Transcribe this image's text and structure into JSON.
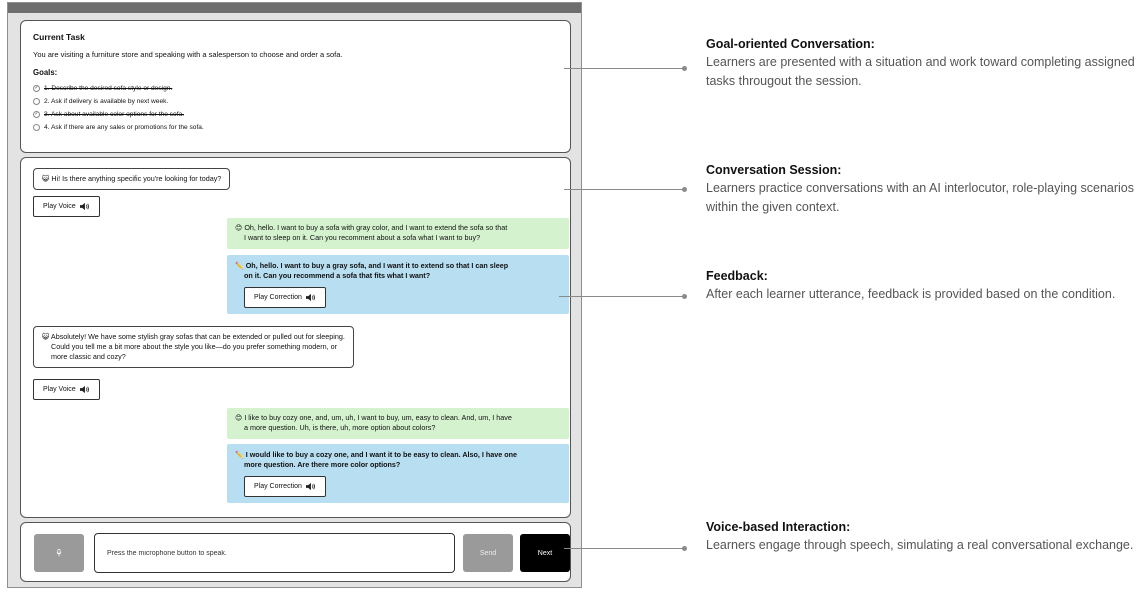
{
  "task": {
    "title": "Current Task",
    "description": "You are visiting a furniture store and speaking with a salesperson to choose and order a sofa.",
    "goals_title": "Goals:",
    "goals": [
      {
        "text": "1. Describe the desired sofa style or design.",
        "done": true
      },
      {
        "text": "2. Ask if delivery is available by next week.",
        "done": false
      },
      {
        "text": "3. Ask about available color options for the sofa.",
        "done": true
      },
      {
        "text": "4. Ask if there are any sales or promotions for the sofa.",
        "done": false
      }
    ]
  },
  "conversation": {
    "ai1": {
      "emoji": "😺",
      "text": "Hi! Is there anything specific you're looking for today?"
    },
    "play_voice_label": "Play Voice",
    "user1": {
      "emoji": "😊",
      "line1": "Oh, hello. I want to buy a sofa with gray color, and I want to extend the sofa so that",
      "line2": "I want to sleep on it. Can you recomment about a sofa what I want to buy?"
    },
    "corr1": {
      "emoji": "✏️",
      "line1": "Oh, hello. I want to buy a gray sofa, and I want it to extend so that I can sleep",
      "line2": "on it. Can you recommend a sofa that fits what I want?"
    },
    "play_correction_label": "Play Correction",
    "ai2": {
      "emoji": "😺",
      "line1": "Absolutely! We have some stylish gray sofas that can be extended or pulled out for sleeping.",
      "line2": "Could you tell me a bit more about the style you like—do you prefer something modern, or",
      "line3": "more classic and cozy?"
    },
    "user2": {
      "emoji": "😊",
      "line1": "I like to buy cozy one, and, um, uh, I want to buy, um, easy to clean. And, um, I have",
      "line2": "a more question. Uh, is there, uh, more option about colors?"
    },
    "corr2": {
      "emoji": "✏️",
      "line1": "I would like to buy a cozy one, and I want it to be easy to clean. Also, I have one",
      "line2": "more question. Are there more color options?"
    }
  },
  "input": {
    "placeholder": "Press the microphone button to speak.",
    "send_label": "Send",
    "next_label": "Next"
  },
  "annotations": [
    {
      "title": "Goal-oriented Conversation:",
      "text": "Learners are presented with a situation and work toward completing assigned tasks througout the session."
    },
    {
      "title": "Conversation Session:",
      "text": "Learners practice conversations with an AI interlocutor, role-playing scenarios within the given context."
    },
    {
      "title": "Feedback:",
      "text": "After each learner utterance, feedback is provided based on the condition."
    },
    {
      "title": "Voice-based Interaction:",
      "text": "Learners engage through speech, simulating a real conversational exchange."
    }
  ]
}
